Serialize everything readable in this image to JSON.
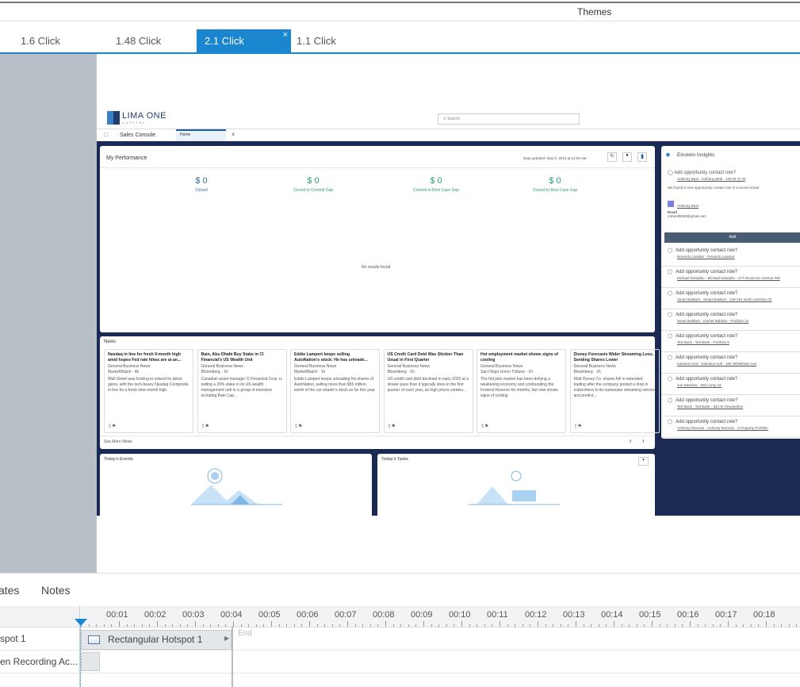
{
  "app": {
    "themes_label": "Themes"
  },
  "tabs": [
    {
      "label": "1.6 Click"
    },
    {
      "label": "1.48 Click"
    },
    {
      "label": "2.1 Click",
      "close": "×"
    },
    {
      "label": "1.1 Click"
    }
  ],
  "sf": {
    "logo": "LIMA ONE",
    "logo_sub": "CAPITAL",
    "search_placeholder": "Search",
    "app_name": "Sales Console",
    "nav_tab": "Home",
    "perf": {
      "title": "My Performance",
      "updated": "Data updated: May 8, 2023 at 12:00 AM",
      "empty": "No results found",
      "metrics": [
        {
          "value": "$ 0",
          "label": "Closed"
        },
        {
          "value": "$ 0",
          "label": "Closed to Commit Gap"
        },
        {
          "value": "$ 0",
          "label": "Commit to Best Case Gap"
        },
        {
          "value": "$ 0",
          "label": "Closed to Best Case Gap"
        }
      ]
    },
    "news": {
      "title": "News",
      "see_more": "See More News",
      "items": [
        {
          "title": "Nasdaq in line for fresh 9-month high amid hopes Fed rate hikes are at an...",
          "cat": "General Business News",
          "src": "MarketWatch · 4h",
          "body": "Wall Street was looking to extend its latest gains, with the tech-heavy Nasdaq Composite in line for a fresh nine-month high."
        },
        {
          "title": "Bain, Abu Dhabi Buy Stake in CI Financial's US Wealth Unit",
          "cat": "General Business News",
          "src": "Bloomberg · 1h",
          "body": "Canadian asset manager CI Financial Corp. is selling a 20% stake in its US wealth management unit to a group of investors including Bain Cap..."
        },
        {
          "title": "Eddie Lampert keeps selling AutoNation's stock: He has unloade...",
          "cat": "General Business News",
          "src": "MarketWatch · 1h",
          "body": "Eddie Lampert keeps unloading his shares of AutoNation, selling more than $55 million worth of the car retailer's stock so far this year."
        },
        {
          "title": "US Credit Card Debt Was Stickier Than Usual in First Quarter",
          "cat": "General Business News",
          "src": "Bloomberg · 1h",
          "body": "US credit card debt declined in early 2023 at a slower pace than it typically does in the first quarter of each year, as high prices continu..."
        },
        {
          "title": "Hot employment market shows signs of cooling",
          "cat": "General Business News",
          "src": "San Diego Union Tribune · 1h",
          "body": "The hot jobs market has been defying a weakening economy and confounding the Federal Reserve for months, but now shows signs of cooling"
        },
        {
          "title": "Disney Forecasts Wider Streaming Loss, Sending Shares Lower",
          "cat": "General Business News",
          "src": "Bloomberg · 2h",
          "body": "Walt Disney Co. shares fell in extended trading after the company posted a drop in subscribers to its namesake streaming service and predict..."
        }
      ]
    },
    "events_title": "Today's Events",
    "tasks_title": "Today's Tasks",
    "einstein": {
      "title": "Einstein Insights",
      "first": {
        "q": "Add opportunity contact role?",
        "s": "Anthony Beal · Anthony Beal - 149 W 37 St",
        "note": "We found a new opportunity contact role in a recent email.",
        "contact": "Anthony Beal",
        "email_label": "Email",
        "email": "mrbeal0056@gmail.com",
        "add": "Add"
      },
      "items": [
        {
          "q": "Add opportunity contact role?",
          "s": "Renardo Lassiter · Renardo Lassiter"
        },
        {
          "q": "Add opportunity contact role?",
          "s": "Michael Deladdio · Michael Deladdio - 277 Reservoir Avenue #40"
        },
        {
          "q": "Add opportunity contact role?",
          "s": "Stuart Baldwin · Stuart Baldwin - 149-151 North Hamilton St"
        },
        {
          "q": "Add opportunity contact role?",
          "s": "Stuart Baldwin · Harriet Baldwin - Portfolio 24"
        },
        {
          "q": "Add opportunity contact role?",
          "s": "Ted Bank · Ted Bank - Portfolio 8"
        },
        {
          "q": "Add opportunity contact role?",
          "s": "Kaimbon Kuli · Kaimbon Kuli - 182 Whitefriars Ave"
        },
        {
          "q": "Add opportunity contact role?",
          "s": "Joe Dawkins · 833 Leray St."
        },
        {
          "q": "Add opportunity contact role?",
          "s": "Ted Bank · Ted Bank - 344 W Alexandrine"
        },
        {
          "q": "Add opportunity contact role?",
          "s": "Anthony Morman · Anthony Morman - 2 Property Portfolio"
        }
      ]
    }
  },
  "bottom": {
    "tabs": [
      "ates",
      "Notes"
    ],
    "ticks": [
      "00:01",
      "00:02",
      "00:03",
      "00:04",
      "00:05",
      "00:06",
      "00:07",
      "00:08",
      "00:09",
      "00:10",
      "00:11",
      "00:12",
      "00:13",
      "00:14",
      "00:15",
      "00:16",
      "00:17",
      "00:18"
    ],
    "rows": [
      "spot 1",
      "en Recording Ac..."
    ],
    "hotspot_label": "Rectangular Hotspot 1",
    "end_label": "End"
  }
}
